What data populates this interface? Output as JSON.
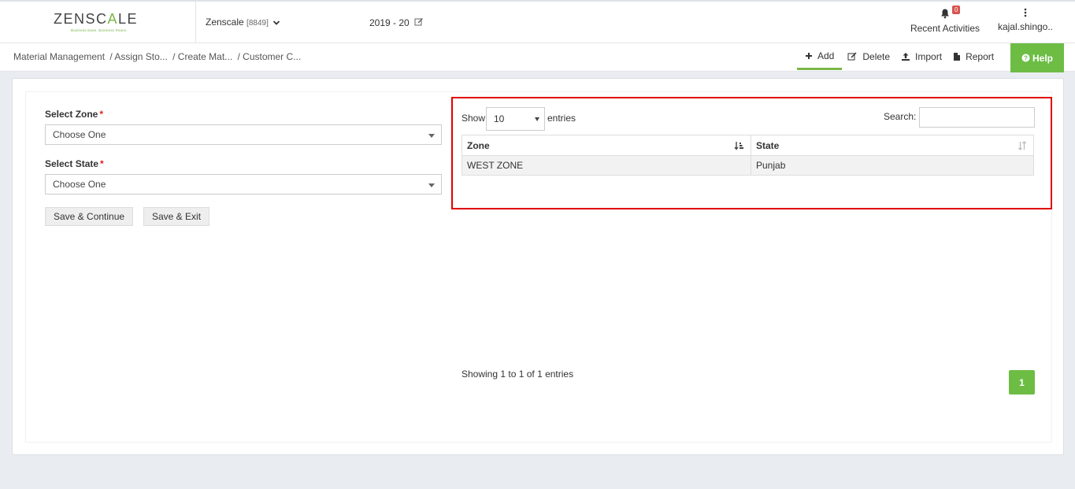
{
  "header": {
    "logo_text_a": "ZENSC",
    "logo_text_b": "A",
    "logo_text_c": "LE",
    "logo_tagline": "Business Ease. Business Peace.",
    "company_name": "Zenscale",
    "company_code": "[8849]",
    "fiscal_year": "2019 - 20",
    "notifications_count": "0",
    "recent_activities_label": "Recent Activities",
    "user_label": "kajal.shingo.."
  },
  "breadcrumb": [
    "Material Management",
    "/ Assign Sto...",
    "/ Create Mat...",
    "/ Customer C..."
  ],
  "actions": {
    "add": "Add",
    "delete": "Delete",
    "import": "Import",
    "report": "Report",
    "help": "Help"
  },
  "form": {
    "zone_label": "Select Zone",
    "zone_value": "Choose One",
    "state_label": "Select State",
    "state_value": "Choose One",
    "required_mark": "*",
    "save_continue": "Save & Continue",
    "save_exit": "Save & Exit"
  },
  "table": {
    "show_label": "Show",
    "page_length": "10",
    "entries_label": "entries",
    "search_label": "Search:",
    "search_value": "",
    "columns": [
      "Zone",
      "State"
    ],
    "rows": [
      [
        "WEST ZONE",
        "Punjab"
      ]
    ],
    "info": "Showing 1 to 1 of 1 entries",
    "current_page": "1"
  },
  "colors": {
    "accent_green": "#6dbd45",
    "highlight_red": "#e00000",
    "badge_red": "#d9534f"
  }
}
